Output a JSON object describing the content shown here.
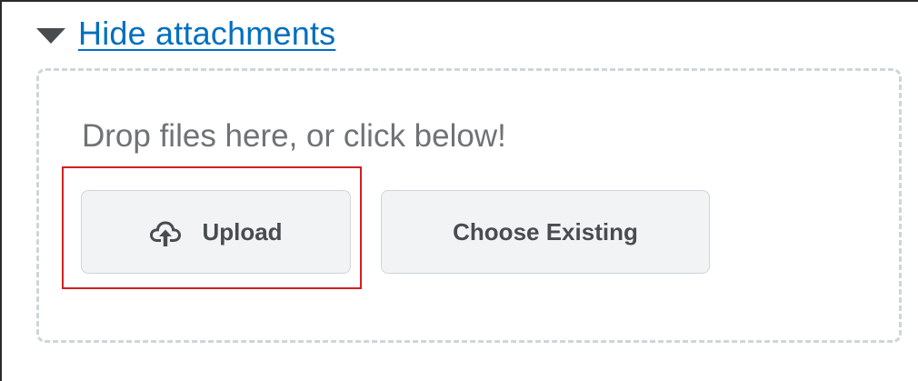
{
  "attachments": {
    "toggle_label": "Hide attachments",
    "drop_text": "Drop files here, or click below!",
    "buttons": {
      "upload_label": "Upload",
      "choose_existing_label": "Choose Existing"
    },
    "icons": {
      "toggle": "caret-down-icon",
      "upload": "cloud-upload-icon"
    }
  },
  "colors": {
    "link": "#006fbf",
    "button_bg": "#f1f3f5",
    "button_border": "#cdd5dc",
    "highlight": "#d21f1f",
    "dashed_border": "#cdd5dc"
  }
}
